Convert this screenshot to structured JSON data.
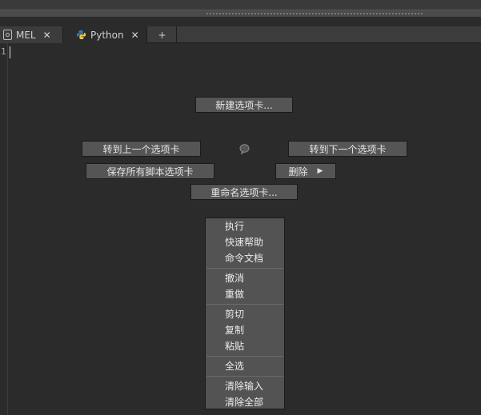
{
  "tabs": [
    {
      "label": "MEL",
      "icon": "mel-script-icon",
      "close": "✕"
    },
    {
      "label": "Python",
      "icon": "python-icon",
      "close": "✕"
    }
  ],
  "add_tab": "+",
  "editor": {
    "line_number": "1"
  },
  "marking_menu": {
    "new_tab": "新建选项卡...",
    "prev_tab": "转到上一个选项卡",
    "next_tab": "转到下一个选项卡",
    "save_all": "保存所有脚本选项卡",
    "delete": "删除",
    "rename": "重命名选项卡..."
  },
  "context_menu": [
    [
      "执行",
      "快速帮助",
      "命令文档"
    ],
    [
      "撤消",
      "重做"
    ],
    [
      "剪切",
      "复制",
      "粘贴"
    ],
    [
      "全选"
    ],
    [
      "清除输入",
      "清除全部"
    ]
  ]
}
